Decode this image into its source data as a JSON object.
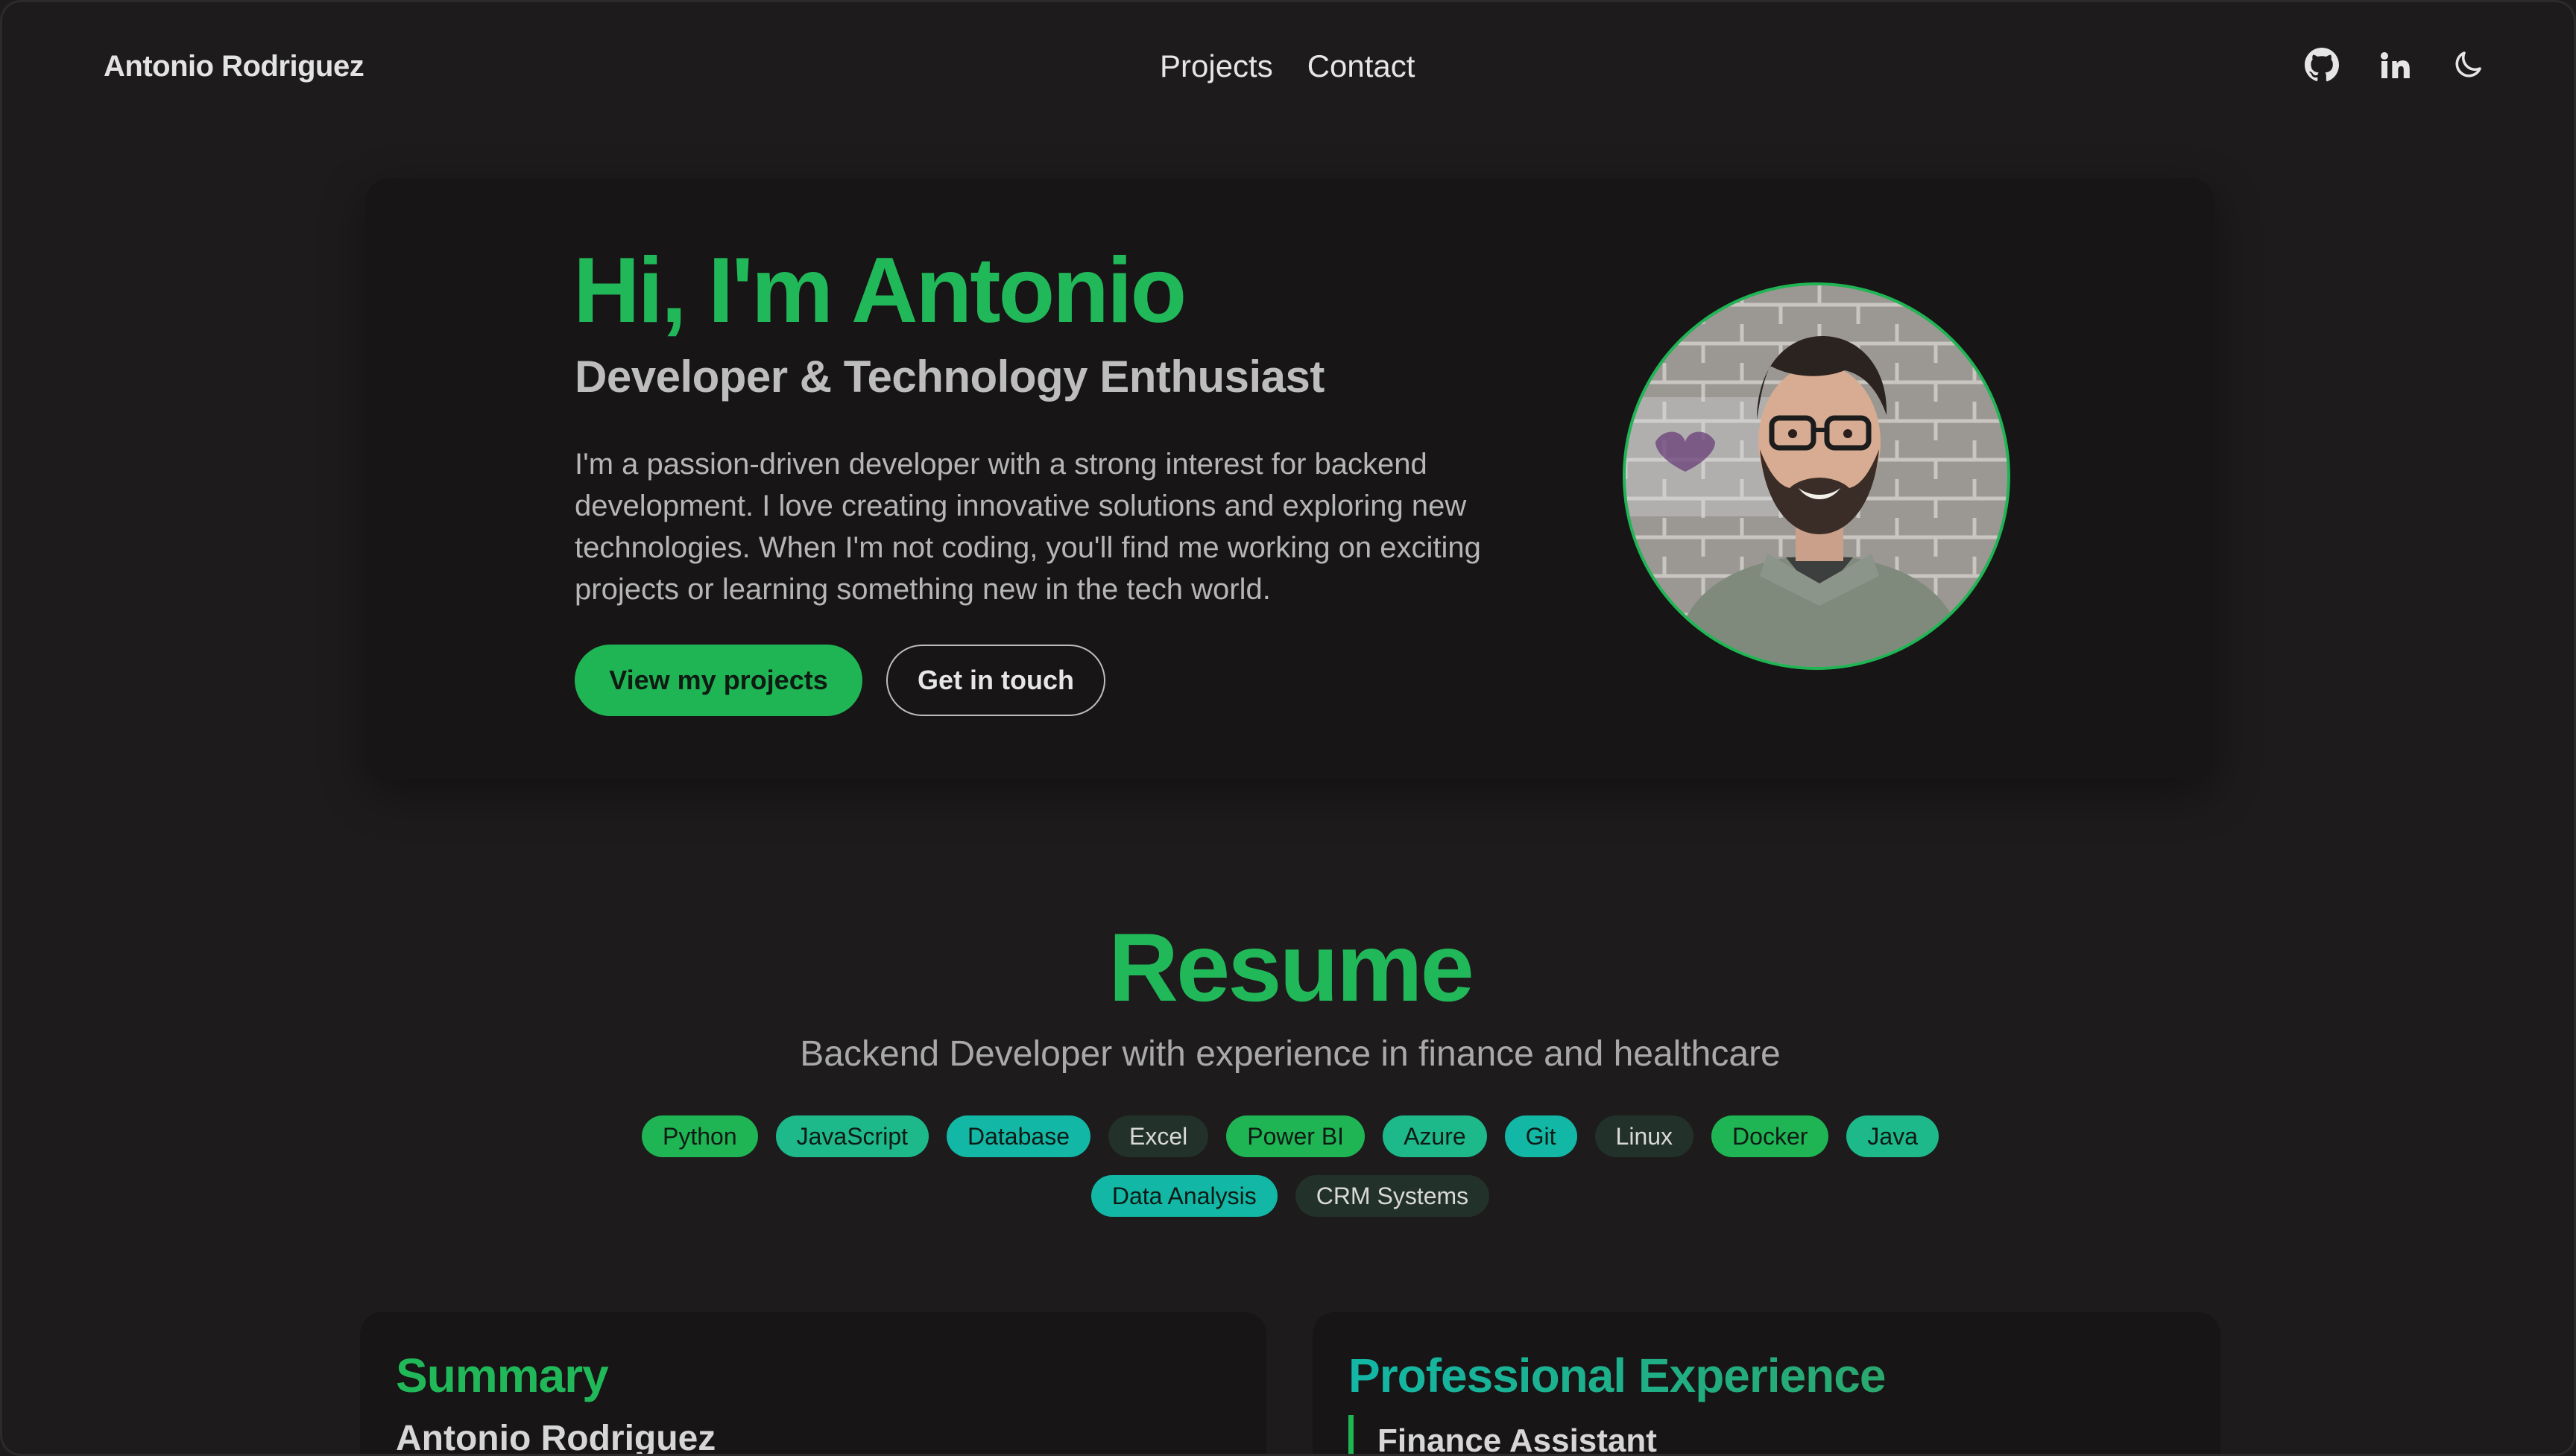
{
  "nav": {
    "brand": "Antonio Rodriguez",
    "links": [
      "Projects",
      "Contact"
    ],
    "icons": [
      "github-icon",
      "linkedin-icon",
      "moon-icon"
    ]
  },
  "hero": {
    "title": "Hi, I'm Antonio",
    "subtitle": "Developer & Technology Enthusiast",
    "description": "I'm a passion-driven developer with a strong interest for backend development. I love creating innovative solutions and exploring new technologies. When I'm not coding, you'll find me working on exciting projects or learning something new in the tech world.",
    "primary_button": "View my projects",
    "secondary_button": "Get in touch",
    "avatar_icon": "profile-photo"
  },
  "resume": {
    "title": "Resume",
    "subtitle": "Backend Developer with experience in finance and healthcare",
    "tags_row1": [
      "Python",
      "JavaScript",
      "Database",
      "Excel",
      "Power BI",
      "Azure",
      "Git",
      "Linux",
      "Docker",
      "Java"
    ],
    "tags_row2": [
      "Data Analysis",
      "CRM Systems"
    ]
  },
  "summary": {
    "heading": "Summary",
    "name": "Antonio Rodriguez"
  },
  "experience": {
    "heading": "Professional Experience",
    "first_role": "Finance Assistant"
  },
  "colors": {
    "accent": "#21b859",
    "teal": "#12b7a6",
    "background": "#1d1b1b",
    "card": "#171515"
  }
}
